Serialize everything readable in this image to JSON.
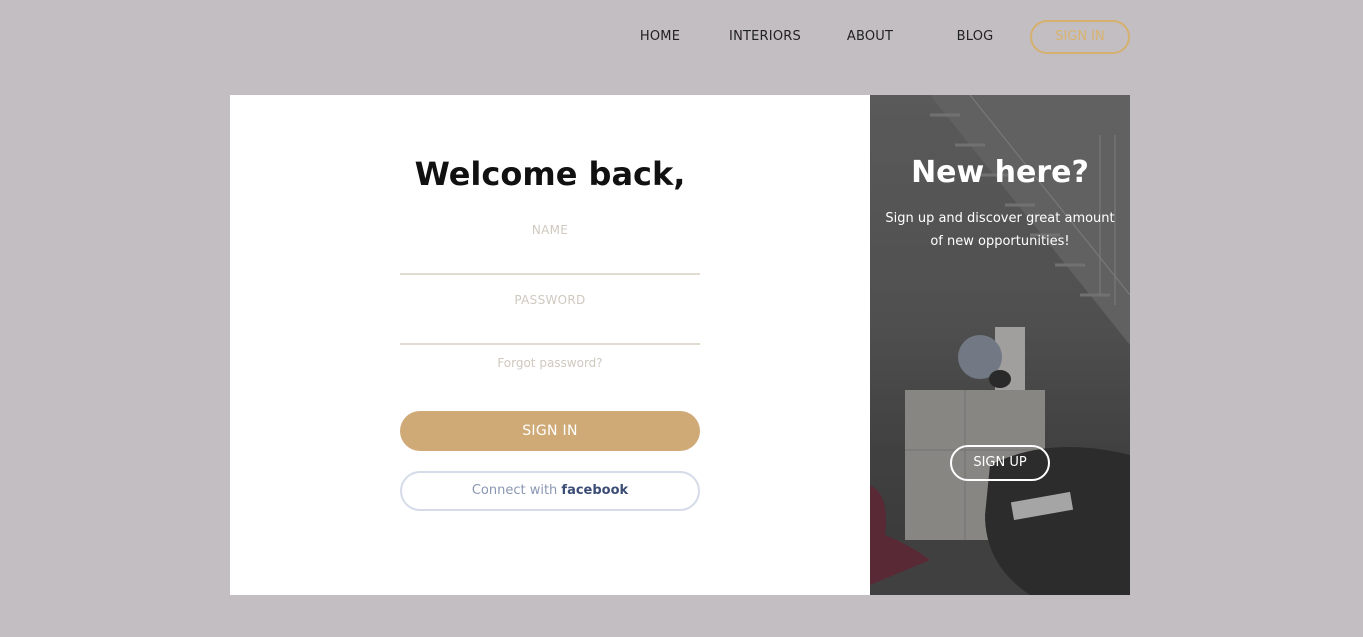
{
  "nav": {
    "home": "HOME",
    "interiors": "INTERIORS",
    "about": "ABOUT",
    "blog": "BLOG",
    "signin": "SIGN IN"
  },
  "login": {
    "title": "Welcome back,",
    "name_label": "NAME",
    "password_label": "PASSWORD",
    "forgot": "Forgot password?",
    "signin_button": "SIGN IN",
    "facebook_prefix": "Connect with",
    "facebook_brand": "facebook"
  },
  "promo": {
    "title": "New here?",
    "subtitle": "Sign up and discover great amount of new opportunities!",
    "signup_button": "SIGN UP"
  },
  "colors": {
    "background": "#c2bec2",
    "accent": "#cfa976",
    "facebook": "#3b4d75"
  }
}
